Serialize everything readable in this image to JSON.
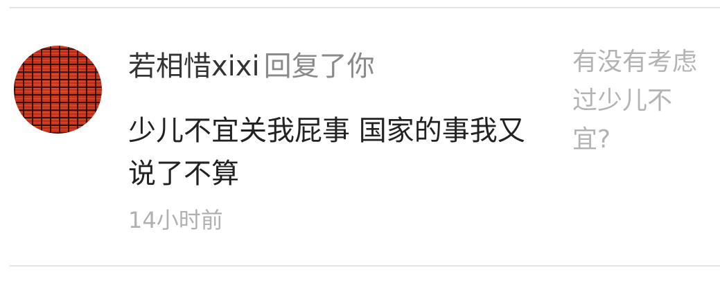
{
  "notification": {
    "username": "若相惜xixi",
    "action_text": "回复了你",
    "reply_content": "少儿不宜关我屁事 国家的事我又说了不算",
    "timestamp": "14小时前",
    "original_comment": "有没有考虑过少儿不宜?"
  },
  "colors": {
    "username": "#333333",
    "action": "#8a8a8a",
    "content": "#222222",
    "timestamp": "#b0b0b0",
    "original_comment": "#b3b3b3",
    "divider": "#e3e3e3",
    "avatar_base": "#c8321b"
  }
}
